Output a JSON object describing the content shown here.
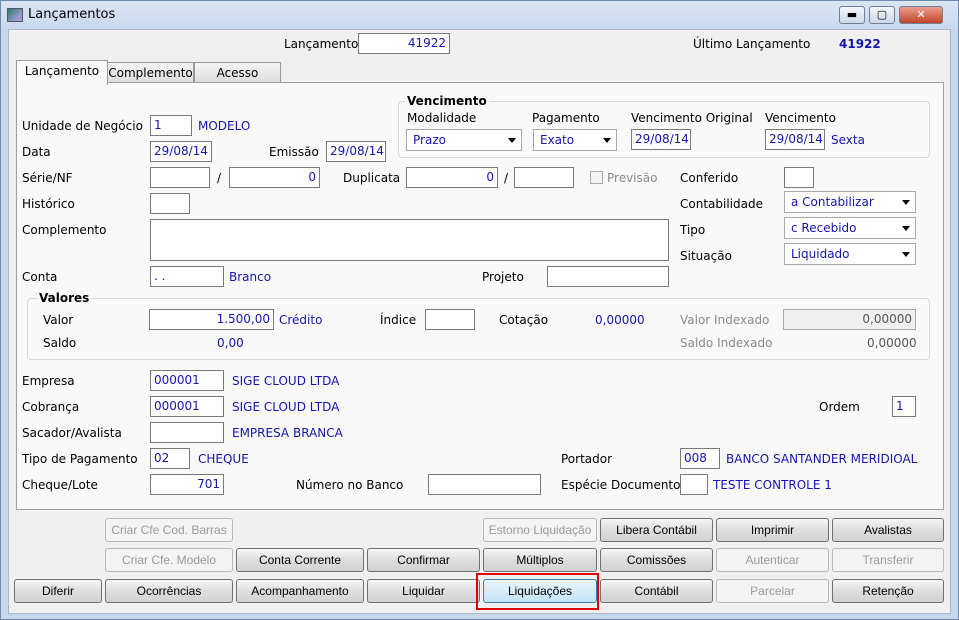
{
  "window": {
    "title": "Lançamentos",
    "minimize": "▬",
    "maximize": "▢",
    "close": "✕"
  },
  "header": {
    "lancamento_label": "Lançamento",
    "lancamento_value": "41922",
    "ultimo_label": "Último Lançamento",
    "ultimo_value": "41922"
  },
  "tabs": [
    {
      "label": "Lançamento",
      "active": true
    },
    {
      "label": "Complemento"
    },
    {
      "label": "Acesso"
    }
  ],
  "form": {
    "unidade_label": "Unidade de Negócio",
    "unidade_value": "1",
    "unidade_desc": "MODELO",
    "data_label": "Data",
    "data_value": "29/08/14",
    "emissao_label": "Emissão",
    "emissao_value": "29/08/14",
    "serie_label": "Série/NF",
    "serie_value": "",
    "nf_sep": "/",
    "nf_value": "0",
    "duplicata_label": "Duplicata",
    "duplicata_value": "0",
    "dup_sep": "/",
    "dup2_value": "",
    "previsao_label": "Previsão",
    "historico_label": "Histórico",
    "historico_value": "",
    "complemento_label": "Complemento",
    "complemento_value": "",
    "conta_label": "Conta",
    "conta_value": ". .",
    "conta_desc": "Branco",
    "projeto_label": "Projeto",
    "projeto_value": "",
    "conferido_label": "Conferido",
    "conferido_value": "",
    "contabilidade_label": "Contabilidade",
    "contabilidade_value": "a Contabilizar",
    "tipo_label": "Tipo",
    "tipo_value": "c Recebido",
    "situacao_label": "Situação",
    "situacao_value": "Liquidado"
  },
  "vencimento": {
    "title": "Vencimento",
    "modalidade_label": "Modalidade",
    "modalidade_value": "Prazo",
    "pagamento_label": "Pagamento",
    "pagamento_value": "Exato",
    "venc_original_label": "Vencimento Original",
    "venc_original_value": "29/08/14",
    "venc_label": "Vencimento",
    "venc_value": "29/08/14",
    "venc_dia": "Sexta"
  },
  "valores": {
    "title": "Valores",
    "valor_label": "Valor",
    "valor_value": "1.500,00",
    "valor_tipo": "Crédito",
    "indice_label": "Índice",
    "indice_value": "",
    "cotacao_label": "Cotação",
    "cotacao_value": "0,00000",
    "valor_indexado_label": "Valor Indexado",
    "valor_indexado_value": "0,00000",
    "saldo_label": "Saldo",
    "saldo_value": "0,00",
    "saldo_indexado_label": "Saldo Indexado",
    "saldo_indexado_value": "0,00000"
  },
  "partes": {
    "empresa_label": "Empresa",
    "empresa_value": "000001",
    "empresa_desc": "SIGE CLOUD LTDA",
    "cobranca_label": "Cobrança",
    "cobranca_value": "000001",
    "cobranca_desc": "SIGE CLOUD LTDA",
    "ordem_label": "Ordem",
    "ordem_value": "1",
    "sacador_label": "Sacador/Avalista",
    "sacador_value": "",
    "sacador_desc": "EMPRESA BRANCA",
    "tipo_pag_label": "Tipo de Pagamento",
    "tipo_pag_value": "02",
    "tipo_pag_desc": "CHEQUE",
    "portador_label": "Portador",
    "portador_value": "008",
    "portador_desc": "BANCO SANTANDER MERIDIOAL",
    "cheque_label": "Cheque/Lote",
    "cheque_value": "701",
    "numero_banco_label": "Número no Banco",
    "numero_banco_value": "",
    "especie_label": "Espécie Documento",
    "especie_value": "",
    "especie_desc": "TESTE CONTROLE 1"
  },
  "buttons": {
    "criar_barras": "Criar Cfe Cod. Barras",
    "estorno": "Estorno Liquidação",
    "libera": "Libera Contábil",
    "imprimir": "Imprimir",
    "avalistas": "Avalistas",
    "criar_modelo": "Criar Cfe. Modelo",
    "conta_corrente": "Conta Corrente",
    "confirmar": "Confirmar",
    "multiplos": "Múltiplos",
    "comissoes": "Comissões",
    "autenticar": "Autenticar",
    "transferir": "Transferir",
    "diferir": "Diferir",
    "ocorrencias": "Ocorrências",
    "acompanhamento": "Acompanhamento",
    "liquidar": "Liquidar",
    "liquidacoes": "Liquidações",
    "contabil": "Contábil",
    "parcelar": "Parcelar",
    "retencao": "Retenção"
  },
  "colors": {
    "value_text": "#1515b0",
    "highlight": "#e00000"
  }
}
